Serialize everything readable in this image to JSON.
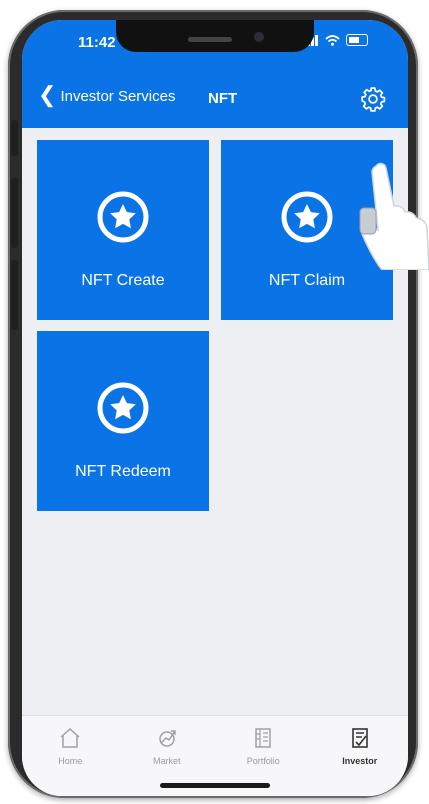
{
  "status": {
    "time": "11:42"
  },
  "nav": {
    "back_label": "Investor Services",
    "title": "NFT"
  },
  "tiles": [
    {
      "label": "NFT Create",
      "icon": "star-circle-icon"
    },
    {
      "label": "NFT Claim",
      "icon": "star-circle-icon"
    },
    {
      "label": "NFT Redeem",
      "icon": "star-circle-icon"
    }
  ],
  "tabbar": {
    "items": [
      {
        "label": "Home",
        "icon": "home-icon",
        "active": false
      },
      {
        "label": "Market",
        "icon": "market-icon",
        "active": false
      },
      {
        "label": "Portfolio",
        "icon": "portfolio-icon",
        "active": false
      },
      {
        "label": "Investor",
        "icon": "investor-icon",
        "active": true
      }
    ]
  },
  "colors": {
    "accent": "#0a74e6",
    "background": "#eeeff3"
  }
}
